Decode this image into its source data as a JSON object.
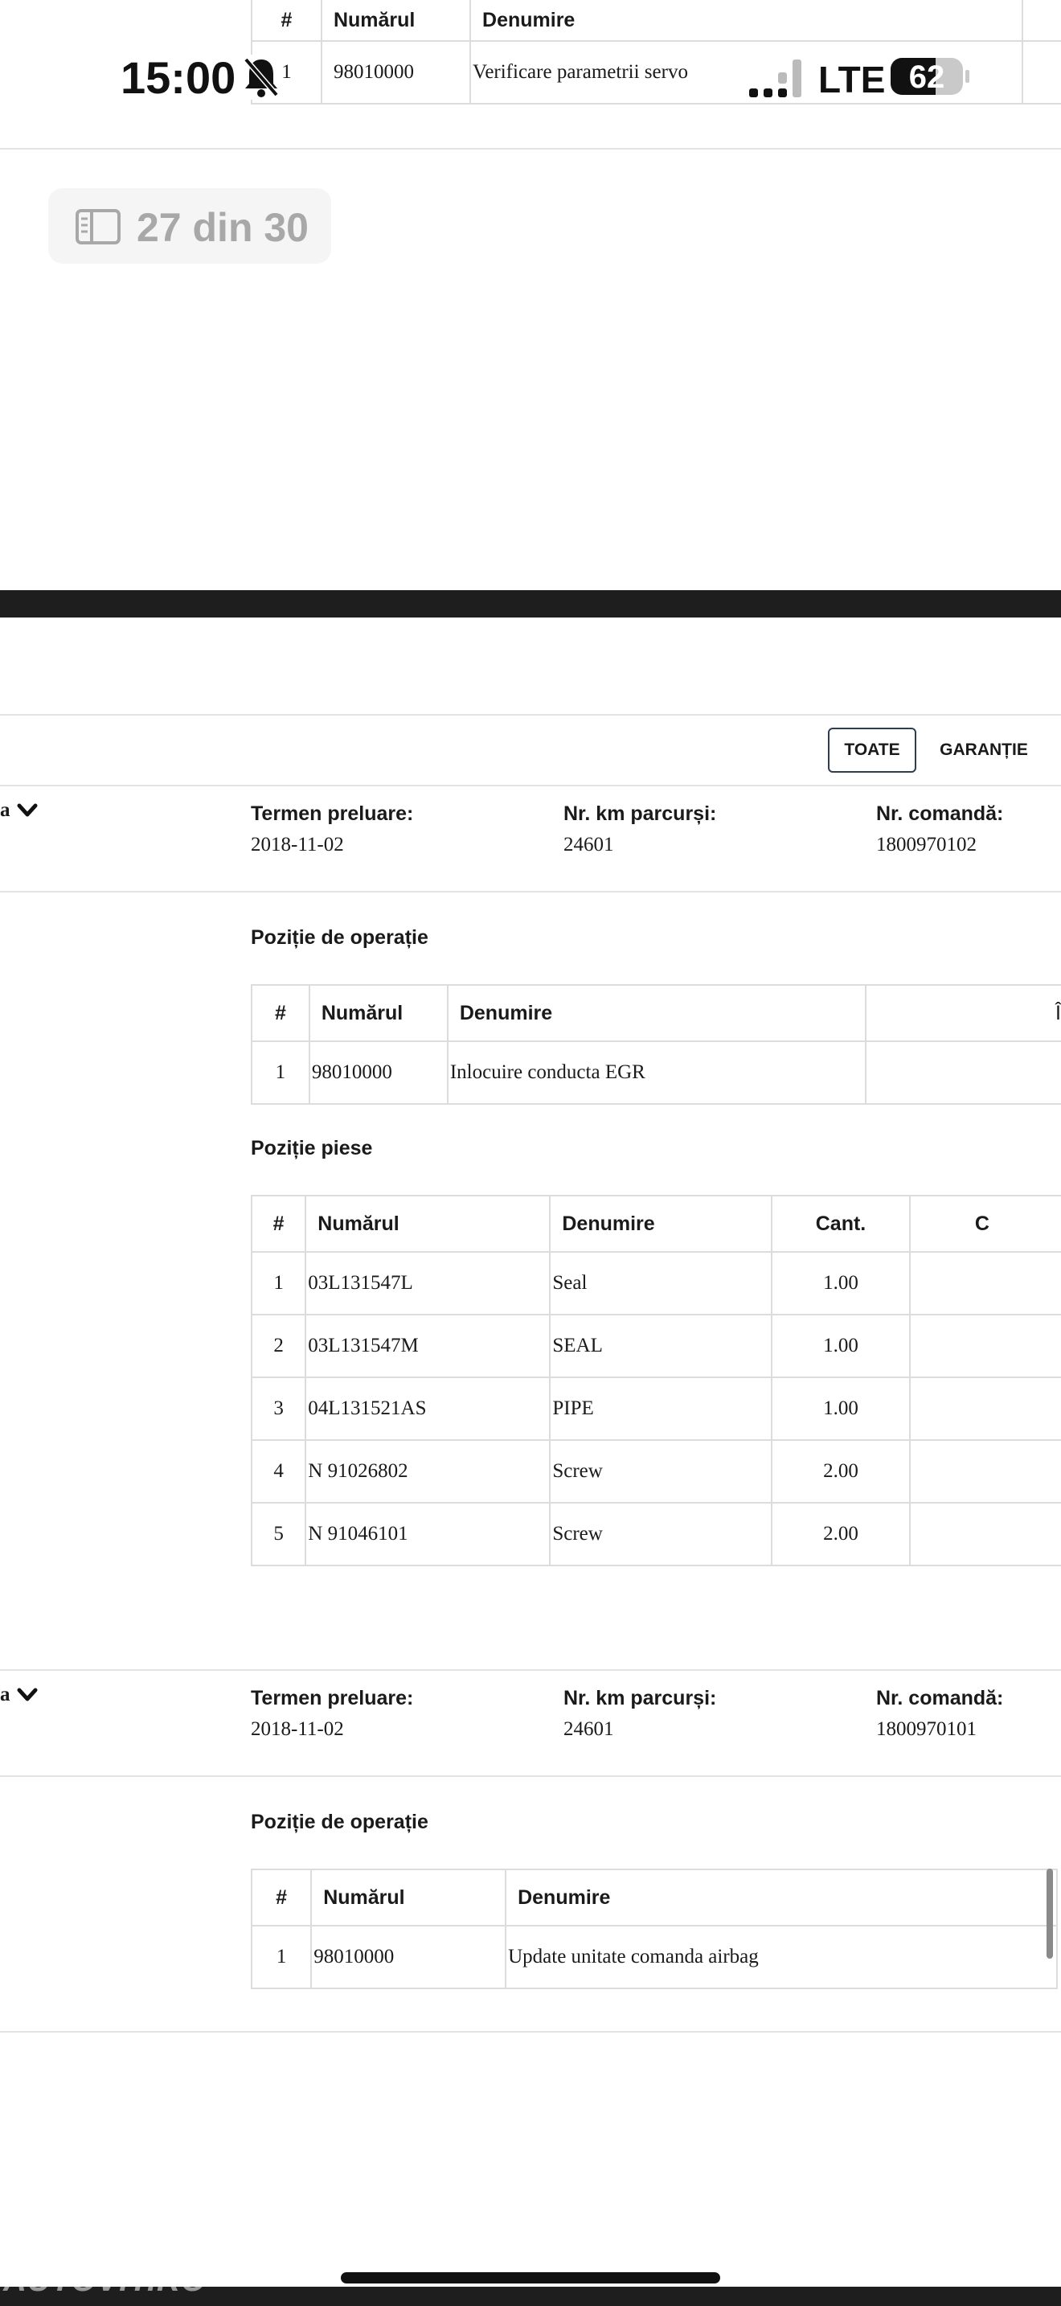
{
  "status_bar": {
    "time": "15:00",
    "network": "LTE",
    "battery": "62"
  },
  "page_indicator": {
    "label": "27 din 30"
  },
  "top_table": {
    "headers": [
      "#",
      "Numărul",
      "Denumire"
    ],
    "row": [
      "1",
      "98010000",
      "Verificare parametrii servo"
    ]
  },
  "filters": {
    "all": "TOATE",
    "warranty": "GARANȚIE"
  },
  "order1": {
    "left_fragment": "a",
    "termen_label": "Termen preluare:",
    "termen_value": "2018-11-02",
    "km_label": "Nr. km parcurși:",
    "km_value": "24601",
    "comanda_label": "Nr. comandă:",
    "comanda_value": "1800970102",
    "ops_title": "Poziție de operație",
    "ops_headers": [
      "#",
      "Numărul",
      "Denumire",
      "Î"
    ],
    "ops_rows": [
      [
        "1",
        "98010000",
        "Inlocuire conducta EGR"
      ]
    ],
    "parts_title": "Poziție piese",
    "parts_headers": [
      "#",
      "Numărul",
      "Denumire",
      "Cant.",
      "C"
    ],
    "parts_rows": [
      [
        "1",
        "03L131547L",
        "Seal",
        "1.00"
      ],
      [
        "2",
        "03L131547M",
        "SEAL",
        "1.00"
      ],
      [
        "3",
        "04L131521AS",
        "PIPE",
        "1.00"
      ],
      [
        "4",
        "N 91026802",
        "Screw",
        "2.00"
      ],
      [
        "5",
        "N 91046101",
        "Screw",
        "2.00"
      ]
    ]
  },
  "order2": {
    "left_fragment": "a",
    "termen_label": "Termen preluare:",
    "termen_value": "2018-11-02",
    "km_label": "Nr. km parcurși:",
    "km_value": "24601",
    "comanda_label": "Nr. comandă:",
    "comanda_value": "1800970101",
    "ops_title": "Poziție de operație",
    "ops_headers": [
      "#",
      "Numărul",
      "Denumire"
    ],
    "ops_rows": [
      [
        "1",
        "98010000",
        "Update unitate comanda airbag"
      ]
    ]
  },
  "watermark": "AUTOVIT.RO",
  "colors": {
    "dark_band": "#1e1e1e",
    "border": "#dcdcdc",
    "pill_bg": "#f5f5f5"
  }
}
